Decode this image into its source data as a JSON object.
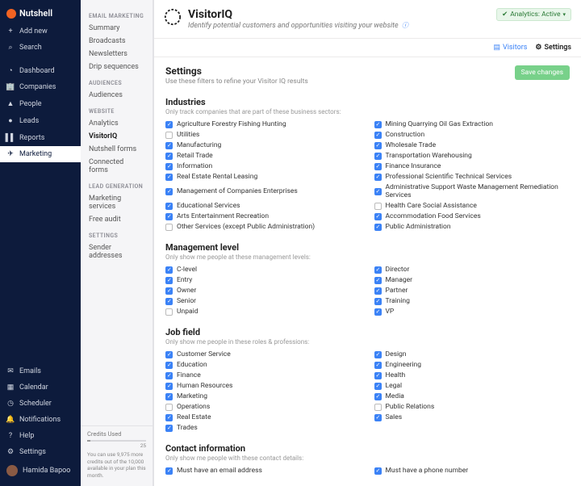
{
  "brand": "Nutshell",
  "sidebar": {
    "add": "Add new",
    "search": "Search",
    "nav": [
      {
        "icon": "◔",
        "label": "Dashboard"
      },
      {
        "icon": "🏢",
        "label": "Companies"
      },
      {
        "icon": "▲",
        "label": "People"
      },
      {
        "icon": "●",
        "label": "Leads"
      },
      {
        "icon": "▌▌",
        "label": "Reports"
      },
      {
        "icon": "✈",
        "label": "Marketing"
      }
    ],
    "bottom": [
      {
        "icon": "✉",
        "label": "Emails"
      },
      {
        "icon": "▦",
        "label": "Calendar"
      },
      {
        "icon": "◷",
        "label": "Scheduler"
      },
      {
        "icon": "🔔",
        "label": "Notifications"
      },
      {
        "icon": "?",
        "label": "Help"
      },
      {
        "icon": "⚙",
        "label": "Settings"
      }
    ],
    "user": "Hamida Bapoo"
  },
  "midbar": {
    "sections": [
      {
        "heading": "EMAIL MARKETING",
        "items": [
          "Summary",
          "Broadcasts",
          "Newsletters",
          "Drip sequences"
        ]
      },
      {
        "heading": "AUDIENCES",
        "items": [
          "Audiences"
        ]
      },
      {
        "heading": "WEBSITE",
        "items": [
          "Analytics",
          "VisitorIQ",
          "Nutshell forms",
          "Connected forms"
        ]
      },
      {
        "heading": "LEAD GENERATION",
        "items": [
          "Marketing services",
          "Free audit"
        ]
      },
      {
        "heading": "SETTINGS",
        "items": [
          "Sender addresses"
        ]
      }
    ],
    "credits": {
      "label": "Credits Used",
      "max": "25",
      "note": "You can use 9,975 more credits out of the 10,000 available in your plan this month."
    }
  },
  "header": {
    "title": "VisitorIQ",
    "subtitle": "Identify potential customers and opportunities visiting your website",
    "badge": "Analytics: Active"
  },
  "tabs": {
    "visitors": "Visitors",
    "settings": "Settings"
  },
  "settings": {
    "title": "Settings",
    "desc": "Use these filters to refine your Visitor IQ results",
    "save": "Save changes"
  },
  "industries": {
    "title": "Industries",
    "hint": "Only track companies that are part of these business sectors:",
    "items": [
      {
        "label": "Agriculture Forestry Fishing Hunting",
        "checked": true
      },
      {
        "label": "Mining Quarrying Oil Gas Extraction",
        "checked": true
      },
      {
        "label": "Utilities",
        "checked": false
      },
      {
        "label": "Construction",
        "checked": true
      },
      {
        "label": "Manufacturing",
        "checked": true
      },
      {
        "label": "Wholesale Trade",
        "checked": true
      },
      {
        "label": "Retail Trade",
        "checked": true
      },
      {
        "label": "Transportation Warehousing",
        "checked": true
      },
      {
        "label": "Information",
        "checked": true
      },
      {
        "label": "Finance Insurance",
        "checked": true
      },
      {
        "label": "Real Estate Rental Leasing",
        "checked": true
      },
      {
        "label": "Professional Scientific Technical Services",
        "checked": true
      },
      {
        "label": "Management of Companies Enterprises",
        "checked": true
      },
      {
        "label": "Administrative Support Waste Management Remediation Services",
        "checked": true
      },
      {
        "label": "Educational Services",
        "checked": true
      },
      {
        "label": "Health Care Social Assistance",
        "checked": false
      },
      {
        "label": "Arts Entertainment Recreation",
        "checked": true
      },
      {
        "label": "Accommodation Food Services",
        "checked": true
      },
      {
        "label": "Other Services (except Public Administration)",
        "checked": false
      },
      {
        "label": "Public Administration",
        "checked": true
      }
    ]
  },
  "management": {
    "title": "Management level",
    "hint": "Only show me people at these management levels:",
    "items": [
      {
        "label": "C-level",
        "checked": true
      },
      {
        "label": "Director",
        "checked": true
      },
      {
        "label": "Entry",
        "checked": true
      },
      {
        "label": "Manager",
        "checked": true
      },
      {
        "label": "Owner",
        "checked": true
      },
      {
        "label": "Partner",
        "checked": true
      },
      {
        "label": "Senior",
        "checked": true
      },
      {
        "label": "Training",
        "checked": true
      },
      {
        "label": "Unpaid",
        "checked": false
      },
      {
        "label": "VP",
        "checked": true
      }
    ]
  },
  "jobfield": {
    "title": "Job field",
    "hint": "Only show me people in these roles & professions:",
    "items": [
      {
        "label": "Customer Service",
        "checked": true
      },
      {
        "label": "Design",
        "checked": true
      },
      {
        "label": "Education",
        "checked": true
      },
      {
        "label": "Engineering",
        "checked": true
      },
      {
        "label": "Finance",
        "checked": true
      },
      {
        "label": "Health",
        "checked": true
      },
      {
        "label": "Human Resources",
        "checked": true
      },
      {
        "label": "Legal",
        "checked": true
      },
      {
        "label": "Marketing",
        "checked": true
      },
      {
        "label": "Media",
        "checked": true
      },
      {
        "label": "Operations",
        "checked": false
      },
      {
        "label": "Public Relations",
        "checked": false
      },
      {
        "label": "Real Estate",
        "checked": true
      },
      {
        "label": "Sales",
        "checked": true
      },
      {
        "label": "Trades",
        "checked": true
      }
    ]
  },
  "contact": {
    "title": "Contact information",
    "hint": "Only show me people with these contact details:",
    "items": [
      {
        "label": "Must have an email address",
        "checked": true
      },
      {
        "label": "Must have a phone number",
        "checked": true
      }
    ]
  }
}
